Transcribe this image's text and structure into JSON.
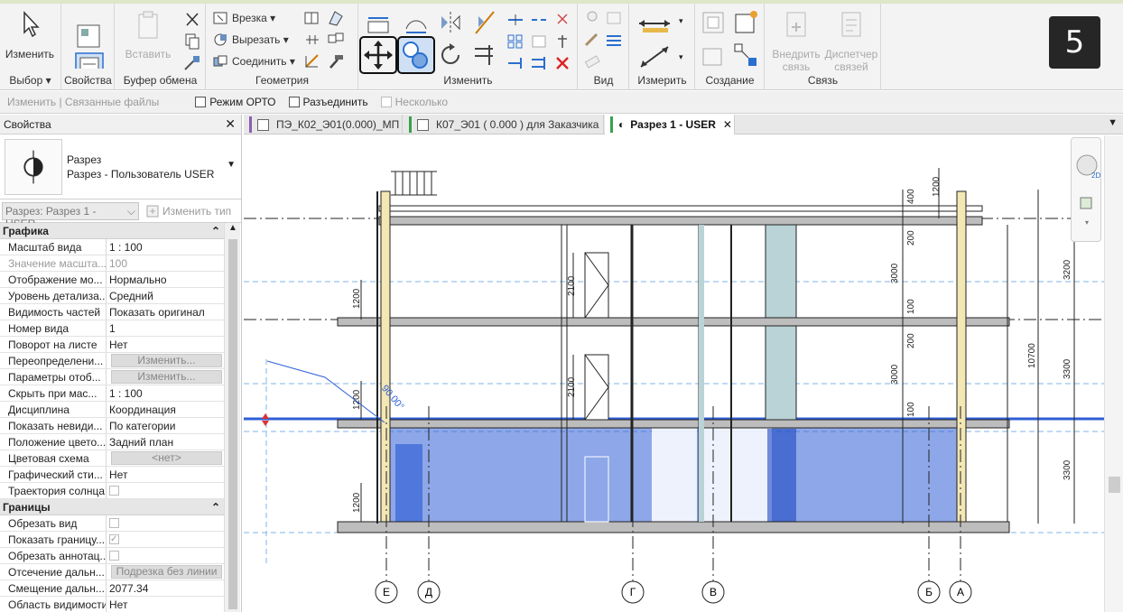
{
  "ribbon": {
    "badge": "5",
    "select": {
      "modify_label": "Изменить",
      "panel_label": "Выбор"
    },
    "properties": {
      "button_label": "Свойства"
    },
    "clipboard": {
      "paste_label": "Вставить",
      "panel_label": "Буфер обмена"
    },
    "geometry": {
      "cope_label": "Врезка",
      "cut_label": "Вырезать",
      "join_label": "Соединить",
      "panel_label": "Геометрия"
    },
    "modify": {
      "panel_label": "Изменить"
    },
    "view": {
      "panel_label": "Вид"
    },
    "measure": {
      "panel_label": "Измерить"
    },
    "create": {
      "panel_label": "Создание"
    },
    "link": {
      "embed_label_1": "Внедрить",
      "embed_label_2": "связь",
      "manager_label_1": "Диспетчер",
      "manager_label_2": "связей",
      "panel_label": "Связь"
    }
  },
  "options_bar": {
    "modify_linked": "Изменить | Связанные файлы",
    "ortho": "Режим ОРТО",
    "disjoin": "Разъединить",
    "multiple": "Несколько"
  },
  "properties": {
    "title": "Свойства",
    "type_name_1": "Разрез",
    "type_name_2": "Разрез - Пользователь USER",
    "instance_selector": "Разрез: Разрез 1 - USER",
    "edit_type": "Изменить тип",
    "groups": [
      {
        "name": "Графика",
        "rows": [
          {
            "k": "Масштаб вида",
            "v": "1 : 100"
          },
          {
            "k": "Значение масшта...",
            "v": "100",
            "dim": true
          },
          {
            "k": "Отображение мо...",
            "v": "Нормально"
          },
          {
            "k": "Уровень детализа...",
            "v": "Средний"
          },
          {
            "k": "Видимость частей",
            "v": "Показать оригинал"
          },
          {
            "k": "Номер вида",
            "v": "1"
          },
          {
            "k": "Поворот на листе",
            "v": "Нет"
          },
          {
            "k": "Переопределени...",
            "v": "Изменить...",
            "button": true
          },
          {
            "k": "Параметры отоб...",
            "v": "Изменить...",
            "button": true
          },
          {
            "k": "Скрыть при мас...",
            "v": "1 : 100"
          },
          {
            "k": "Дисциплина",
            "v": "Координация"
          },
          {
            "k": "Показать невиди...",
            "v": "По категории"
          },
          {
            "k": "Положение цвето...",
            "v": "Задний план"
          },
          {
            "k": "Цветовая схема",
            "v": "<нет>",
            "button": true
          },
          {
            "k": "Графический сти...",
            "v": "Нет"
          },
          {
            "k": "Траектория солнца",
            "v": "",
            "check": "off"
          }
        ]
      },
      {
        "name": "Границы",
        "rows": [
          {
            "k": "Обрезать вид",
            "v": "",
            "check": "off"
          },
          {
            "k": "Показать границу...",
            "v": "",
            "check": "on"
          },
          {
            "k": "Обрезать аннотац...",
            "v": "",
            "check": "off"
          },
          {
            "k": "Отсечение дальн...",
            "v": "Подрезка без линии",
            "button": true
          },
          {
            "k": "Смещение дальн...",
            "v": "2077.34"
          },
          {
            "k": "Область видимости",
            "v": "Нет"
          }
        ]
      }
    ]
  },
  "tabs": [
    {
      "label": "ПЭ_К02_Э01(0.000)_МП",
      "color": "#8a5fb0"
    },
    {
      "label": "К07_Э01 ( 0.000 ) для Заказчика",
      "color": "#3aa04a"
    },
    {
      "label": "Разрез 1 - USER",
      "color": "#3aa04a",
      "active": true
    }
  ],
  "drawing": {
    "axes": [
      "Е",
      "Д",
      "Г",
      "В",
      "Б",
      "А"
    ],
    "dims_right": [
      "3200",
      "3300",
      "3300",
      "10700"
    ],
    "dims_inner": [
      "400",
      "1200",
      "200",
      "3000",
      "100",
      "200",
      "3000",
      "100"
    ],
    "dims_left": [
      "1200",
      "1200",
      "1200"
    ],
    "door_dims": [
      "2100",
      "2100"
    ],
    "angle_label": "90.00°",
    "colors": {
      "selection": "#2f5fd6",
      "accent": "#3aa04a"
    }
  }
}
